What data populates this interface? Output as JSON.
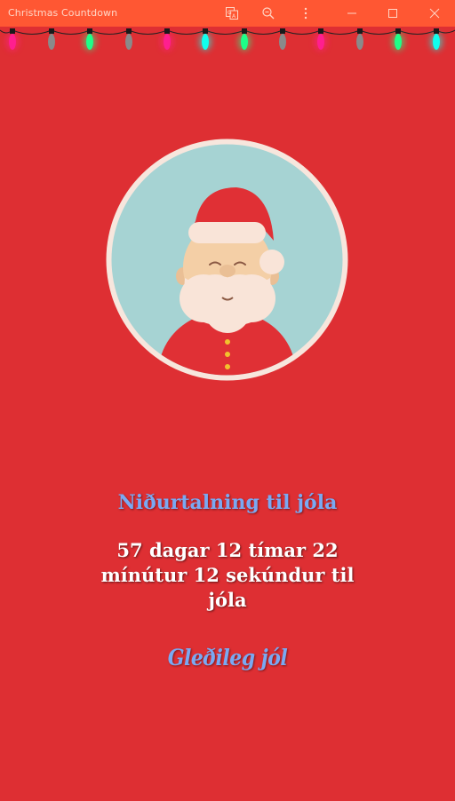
{
  "window": {
    "title": "Christmas Countdown"
  },
  "titlebar_icons": [
    "translate-icon",
    "zoom-icon",
    "more-options-icon",
    "minimize-icon",
    "maximize-icon",
    "close-icon"
  ],
  "lights": {
    "colors": [
      "#ff1f8f",
      "#8a8a8a",
      "#1dff88",
      "#8a8a8a",
      "#ff1f8f",
      "#10ffee",
      "#1dff88",
      "#8a8a8a",
      "#ff1f8f",
      "#8a8a8a",
      "#1dff88",
      "#10ffee"
    ]
  },
  "main": {
    "heading": "Niðurtalning til jóla",
    "countdown_lines": [
      "57 dagar 12 tímar 22",
      "mínútur 12 sekúndur til",
      "jóla"
    ],
    "greeting": "Gleðileg jól"
  },
  "colors": {
    "background": "#de2f33",
    "titlebar": "#ff5733",
    "heading": "#7aa9f2",
    "avatar_bg": "#a6d3d3",
    "avatar_ring": "#f7e6dd",
    "santa_red": "#e03035"
  }
}
